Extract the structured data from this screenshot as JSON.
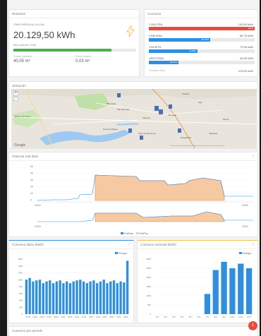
{
  "resumen": {
    "title": "Resumen",
    "label": "CMIN MENSUAL ACUAL",
    "value": "20.129,50 kWh",
    "subtitle": "Mes anterior 2018",
    "progress": 0.8,
    "left_small": "Fuente estimado",
    "left_value": "40,05 m³",
    "right_small": "Precio unitario",
    "right_value": "0,03 m³",
    "bolt_color": "#f2c14e"
  },
  "consumo": {
    "title": "Consumo",
    "items": [
      {
        "name": "CUEUTRA",
        "value": "100,00 kWh",
        "bar_label": "100%",
        "fraction": 1.0,
        "color": "#e74c3c"
      },
      {
        "name": "CNELENA",
        "value": "65,78 kWh",
        "bar_label": "65,78%",
        "fraction": 0.58,
        "color": "#2f8fde"
      },
      {
        "name": "CNCIETA",
        "value": "73,36 kWh",
        "bar_label": "73,36%",
        "fraction": 0.46,
        "color": "#2f8fde"
      },
      {
        "name": "VERTLENA",
        "value": "40,35 kWh",
        "bar_label": "40,35%",
        "fraction": 0.28,
        "color": "#2f8fde"
      }
    ],
    "total_label": "Consumo total",
    "total_value": "276,50 kWh"
  },
  "ubicacion": {
    "title": "Ubicación",
    "zoom_in": "+",
    "zoom_out": "−",
    "places": [
      "Mirandela",
      "Sanfins de Douro",
      "Chaves",
      "Alijó",
      "São Mamede",
      "Sabrosa",
      "Vila Real",
      "Murça",
      "Peso da Régua",
      "Valpaços",
      "Torre de Moncorvo",
      "Mogadouro"
    ],
    "google": "Google",
    "attribution": "Datos del mapa ©2018 Google  Términos de uso  Informar de un error del mapa"
  },
  "potencia": {
    "title": "Potencia real (kW)",
    "y_ticks": [
      "50",
      "40",
      "30",
      "20",
      "10",
      "0"
    ],
    "x_start": "22/04\n00:00",
    "x_end": "23/04\n00:00",
    "legend": [
      "PotReal",
      "PotPico"
    ],
    "colors": {
      "line": "#2f8fde",
      "fill": "#f6c9a2",
      "edge": "#e8894a"
    }
  },
  "diario": {
    "title": "Consumo diario (kWh)",
    "legend": "Energía",
    "y_ticks": [
      "1600",
      "1400",
      "1200",
      "1000",
      "800",
      "600",
      "400",
      "200",
      "0"
    ],
    "values": [
      1000,
      1050,
      950,
      980,
      1000,
      900,
      950,
      980,
      900,
      950,
      980,
      900,
      950,
      900,
      950,
      980,
      1000,
      950,
      900,
      950,
      980,
      900,
      950,
      1000,
      900,
      950,
      980,
      900,
      950,
      920,
      1550
    ],
    "x_labels": [
      "01/04",
      "03/04",
      "05/04",
      "07/04",
      "09/04",
      "11/04",
      "13/04",
      "15/04",
      "17/04",
      "19/04",
      "21/04",
      "23/04",
      "25/04",
      "27/04",
      "29/04"
    ],
    "color": "#2f8fde",
    "accent": "#2f8fde"
  },
  "mensual": {
    "title": "Consumo mensual (kWh)",
    "legend": "Energía",
    "y_ticks": [
      "3000",
      "2500",
      "2000",
      "1500",
      "1000",
      "500",
      "0"
    ],
    "values": [
      0,
      0,
      0,
      0,
      0,
      0,
      1100,
      2400,
      2850,
      2500,
      2750,
      2500
    ],
    "x_labels": [
      "1/17",
      "2/17",
      "3/17",
      "4/17",
      "5/17",
      "6/17",
      "7/17",
      "8/17",
      "9/17",
      "10/17",
      "11/17",
      "12/17"
    ],
    "color": "#2f8fde",
    "accent": "#f2c14e"
  },
  "bottom": {
    "title": "Consumo por periodo",
    "badge": "1"
  }
}
